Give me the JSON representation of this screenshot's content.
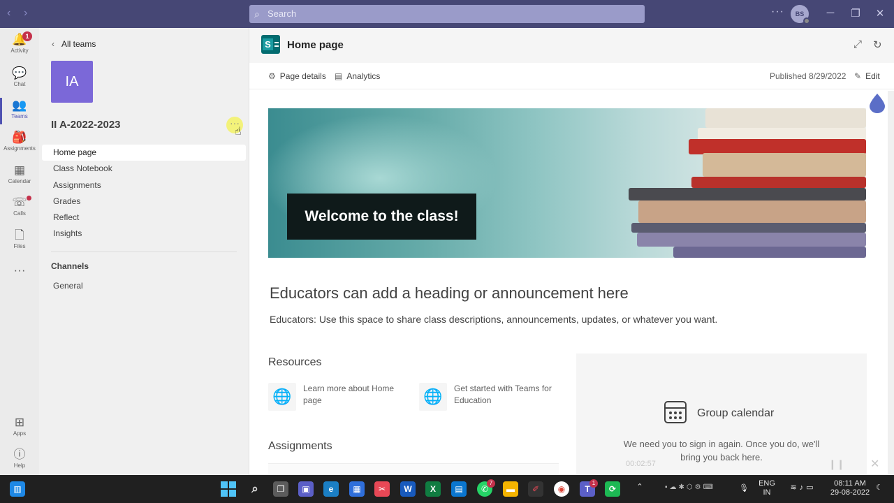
{
  "window": {
    "search_placeholder": "Search",
    "avatar_initials": "BS",
    "more_label": "···"
  },
  "rail": {
    "items": [
      {
        "label": "Activity",
        "icon": "bell-icon",
        "glyph": "🔔",
        "badge": "1"
      },
      {
        "label": "Chat",
        "icon": "chat-icon",
        "glyph": "💬"
      },
      {
        "label": "Teams",
        "icon": "teams-icon",
        "glyph": "👥",
        "active": true
      },
      {
        "label": "Assignments",
        "icon": "backpack-icon",
        "glyph": "🎒"
      },
      {
        "label": "Calendar",
        "icon": "calendar-icon",
        "glyph": "▦"
      },
      {
        "label": "Calls",
        "icon": "phone-icon",
        "glyph": "☏",
        "dot": true
      },
      {
        "label": "Files",
        "icon": "file-icon",
        "glyph": "🗋"
      }
    ],
    "more": "···",
    "apps_label": "Apps",
    "help_label": "Help"
  },
  "team": {
    "back_label": "All teams",
    "avatar_text": "IA",
    "name": "II A-2022-2023",
    "more": "···",
    "nav": [
      "Home page",
      "Class Notebook",
      "Assignments",
      "Grades",
      "Reflect",
      "Insights"
    ],
    "channels_heading": "Channels",
    "channels": [
      "General"
    ]
  },
  "page": {
    "title": "Home page",
    "page_details": "Page details",
    "analytics": "Analytics",
    "published": "Published 8/29/2022",
    "edit": "Edit",
    "banner_text": "Welcome to the class!",
    "heading": "Educators can add a heading or announcement here",
    "subtext": "Educators: Use this space to share class descriptions, announcements, updates, or whatever you want.",
    "resources_heading": "Resources",
    "resources": [
      "Learn more about Home page",
      "Get started with Teams for Education"
    ],
    "assignments_heading": "Assignments",
    "calendar_title": "Group calendar",
    "calendar_message": "We need you to sign in again. Once you do, we'll bring you back here."
  },
  "video_overlay": {
    "time": "00:02:57"
  },
  "taskbar": {
    "lang_top": "ENG",
    "lang_bottom": "IN",
    "time": "08:11 AM",
    "date": "29-08-2022",
    "whatsapp_badge": "7",
    "teams_badge": "1"
  }
}
